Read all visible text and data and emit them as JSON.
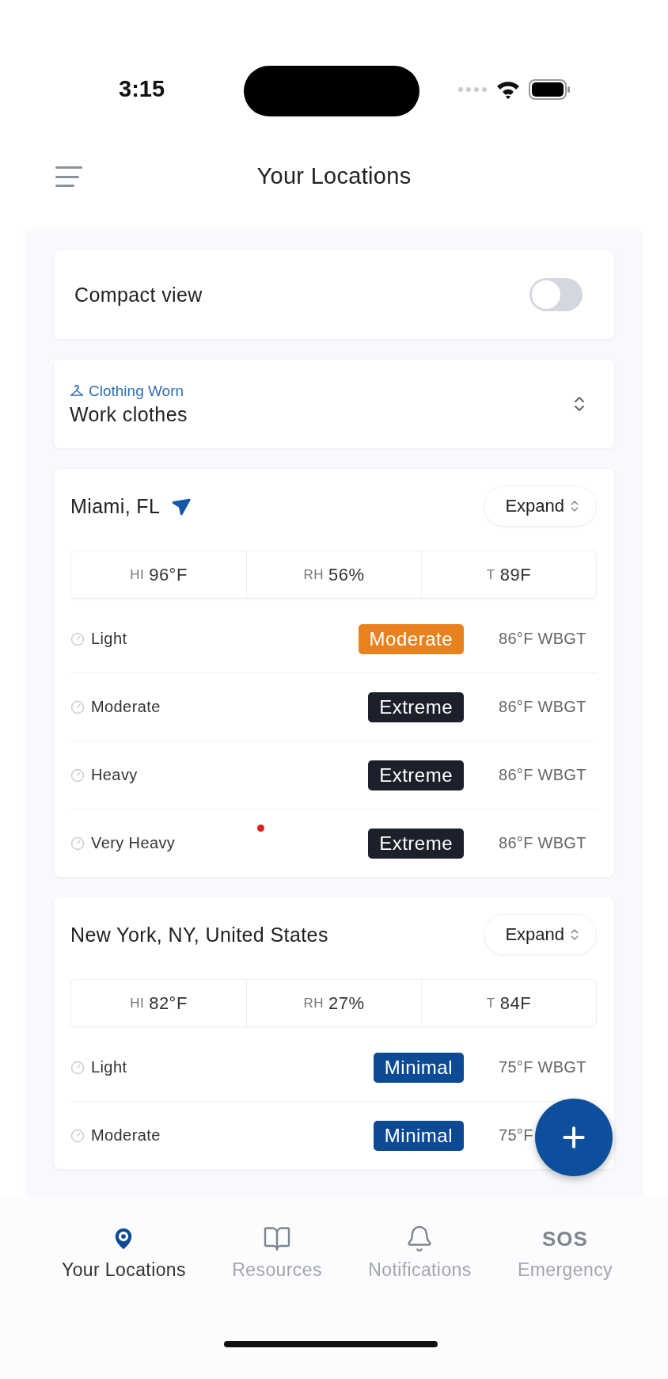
{
  "status_bar": {
    "time": "3:15"
  },
  "header": {
    "title": "Your Locations"
  },
  "compact_view": {
    "label": "Compact view",
    "on": false
  },
  "clothing": {
    "label": "Clothing Worn",
    "value": "Work clothes"
  },
  "locations": [
    {
      "name": "Miami, FL",
      "current": true,
      "expand": "Expand",
      "stats": [
        {
          "label": "HI",
          "value": "96°F"
        },
        {
          "label": "RH",
          "value": "56%"
        },
        {
          "label": "T",
          "value": "89F"
        }
      ],
      "rows": [
        {
          "activity": "Light",
          "risk": "Moderate",
          "color": "#e8821e",
          "wbgt": "86°F WBGT"
        },
        {
          "activity": "Moderate",
          "risk": "Extreme",
          "color": "#1b202b",
          "wbgt": "86°F WBGT"
        },
        {
          "activity": "Heavy",
          "risk": "Extreme",
          "color": "#1b202b",
          "wbgt": "86°F WBGT"
        },
        {
          "activity": "Very Heavy",
          "risk": "Extreme",
          "color": "#1b202b",
          "wbgt": "86°F WBGT"
        }
      ]
    },
    {
      "name": "New York, NY, United States",
      "current": false,
      "expand": "Expand",
      "stats": [
        {
          "label": "HI",
          "value": "82°F"
        },
        {
          "label": "RH",
          "value": "27%"
        },
        {
          "label": "T",
          "value": "84F"
        }
      ],
      "rows": [
        {
          "activity": "Light",
          "risk": "Minimal",
          "color": "#0d4a94",
          "wbgt": "75°F WBGT"
        },
        {
          "activity": "Moderate",
          "risk": "Minimal",
          "color": "#0d4a94",
          "wbgt": "75°F"
        }
      ]
    }
  ],
  "tabs": [
    {
      "kind": "pin",
      "label": "Your Locations",
      "selected": true
    },
    {
      "kind": "book",
      "label": "Resources",
      "selected": false
    },
    {
      "kind": "bell",
      "label": "Notifications",
      "selected": false
    },
    {
      "kind": "text",
      "icon_text": "SOS",
      "label": "Emergency",
      "selected": false
    }
  ]
}
